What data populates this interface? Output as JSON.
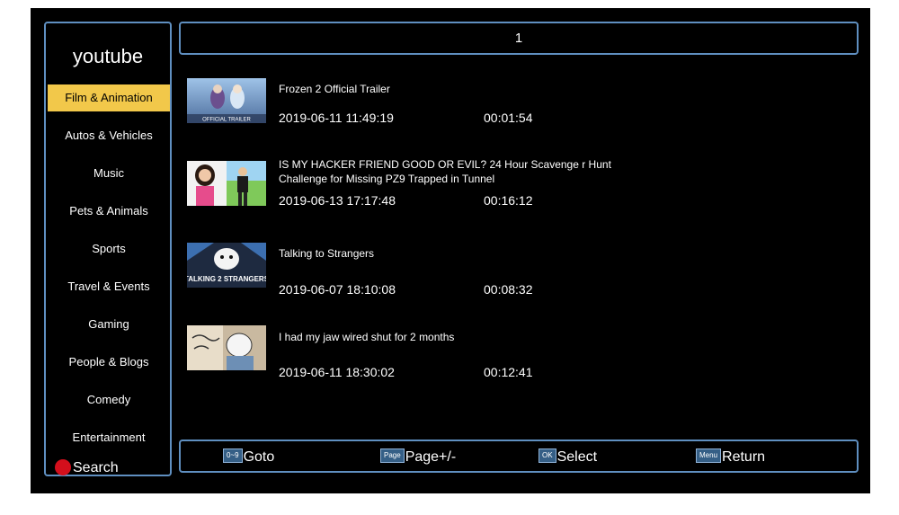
{
  "app": {
    "title": "youtube"
  },
  "categories": [
    {
      "label": "Film & Animation"
    },
    {
      "label": "Autos & Vehicles"
    },
    {
      "label": "Music"
    },
    {
      "label": "Pets & Animals"
    },
    {
      "label": "Sports"
    },
    {
      "label": "Travel & Events"
    },
    {
      "label": "Gaming"
    },
    {
      "label": "People & Blogs"
    },
    {
      "label": "Comedy"
    },
    {
      "label": "Entertainment"
    }
  ],
  "search": {
    "label": "Search"
  },
  "page": {
    "number": "1"
  },
  "videos": [
    {
      "title": "Frozen 2 Official Trailer",
      "date": "2019-06-11 11:49:19",
      "duration": "00:01:54",
      "thumb_text": "OFFICIAL TRAILER"
    },
    {
      "title": "IS MY HACKER FRIEND GOOD OR EVIL? 24 Hour Scavenge r Hunt Challenge for Missing PZ9 Trapped in Tunnel",
      "date": "2019-06-13 17:17:48",
      "duration": "00:16:12",
      "thumb_text": ""
    },
    {
      "title": "Talking to Strangers",
      "date": "2019-06-07 18:10:08",
      "duration": "00:08:32",
      "thumb_text": "TALKING 2 STRANGERS"
    },
    {
      "title": "I had my jaw wired shut for 2 months",
      "date": "2019-06-11 18:30:02",
      "duration": "00:12:41",
      "thumb_text": ""
    }
  ],
  "footer": {
    "goto": {
      "key": "0~9",
      "label": "Goto"
    },
    "page": {
      "key": "Page",
      "label": "Page+/-"
    },
    "select": {
      "key": "OK",
      "label": "Select"
    },
    "return": {
      "key": "Menu",
      "label": "Return"
    }
  },
  "colors": {
    "active_category": "#f2c84a",
    "frame": "#5f8fc0",
    "search_dot": "#d40f1c"
  }
}
